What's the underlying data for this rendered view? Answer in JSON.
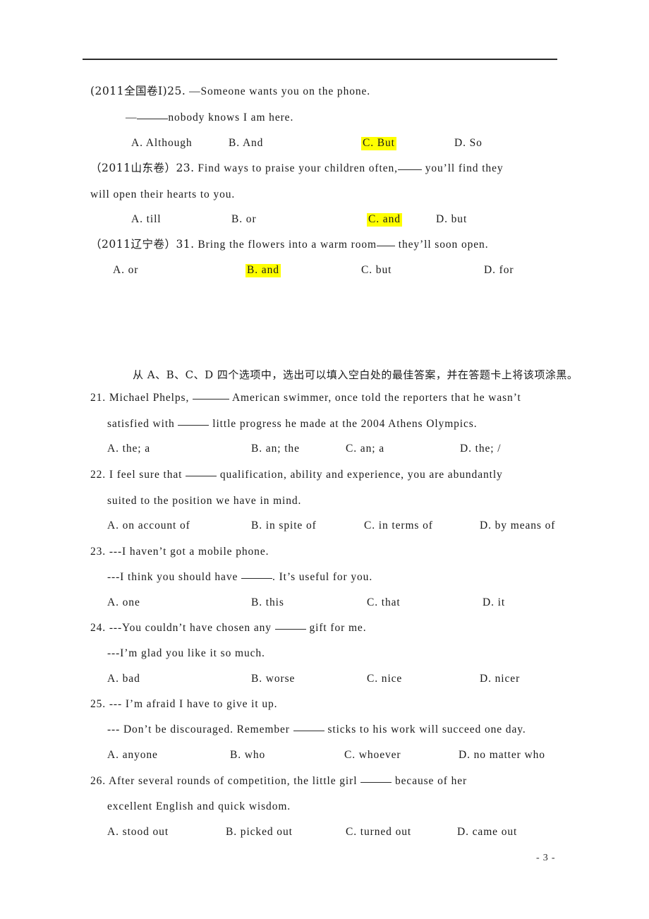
{
  "document": {
    "page_number_label": "- 3 -",
    "highlight_color": "#FFFF00",
    "rule_color": "#2b2b2b"
  },
  "section_one": {
    "items": [
      {
        "source": "(2011全国卷I)25.",
        "stem_line1": "—Someone wants you on the phone.",
        "stem_line2_pre": "—",
        "stem_line2_post": "nobody knows I am here.",
        "options": [
          {
            "key": "A.",
            "text": "Although",
            "highlighted": false
          },
          {
            "key": "B.",
            "text": "And",
            "highlighted": false
          },
          {
            "key": "C.",
            "text": "But",
            "highlighted": true
          },
          {
            "key": "D.",
            "text": "So",
            "highlighted": false
          }
        ]
      },
      {
        "source": "（2011山东卷）23.",
        "stem_line1_a": "Find ways to praise your children often,",
        "stem_line1_b": "you’ll find they",
        "stem_line2": "will open their hearts to you.",
        "options": [
          {
            "key": "A.",
            "text": "till",
            "highlighted": false
          },
          {
            "key": "B.",
            "text": "or",
            "highlighted": false
          },
          {
            "key": "C.",
            "text": "and",
            "highlighted": true
          },
          {
            "key": "D.",
            "text": "but",
            "highlighted": false
          }
        ]
      },
      {
        "source": "（2011辽宁卷）31.",
        "stem_line1_a": "Bring the flowers into a warm room",
        "stem_line1_b": "they’ll soon open.",
        "options": [
          {
            "key": "A.",
            "text": "or",
            "highlighted": false
          },
          {
            "key": "B.",
            "text": "and",
            "highlighted": true
          },
          {
            "key": "C.",
            "text": "but",
            "highlighted": false
          },
          {
            "key": "D.",
            "text": "for",
            "highlighted": false
          }
        ]
      }
    ]
  },
  "section_two": {
    "instruction": "从 A、B、C、D 四个选项中，选出可以填入空白处的最佳答案，并在答题卡上将该项涂黑。",
    "questions": [
      {
        "number": "21.",
        "line1_a": "Michael Phelps,",
        "line1_b": "American swimmer, once told the reporters that he wasn’t",
        "line2_a": "satisfied with",
        "line2_b": "little progress he made at the 2004 Athens Olympics.",
        "options": [
          {
            "key": "A.",
            "text": "the; a"
          },
          {
            "key": "B.",
            "text": "an; the"
          },
          {
            "key": "C.",
            "text": "an; a"
          },
          {
            "key": "D.",
            "text": "the; /"
          }
        ]
      },
      {
        "number": "22.",
        "line1_a": "I feel sure that",
        "line1_b": "qualification, ability and experience, you are abundantly",
        "line2_a": "suited to the position we have in mind.",
        "options": [
          {
            "key": "A.",
            "text": "on account of"
          },
          {
            "key": "B.",
            "text": "in spite of"
          },
          {
            "key": "C.",
            "text": "in terms of"
          },
          {
            "key": "D.",
            "text": "by means of"
          }
        ]
      },
      {
        "number": "23.",
        "line1_a": "---I haven’t got a mobile phone.",
        "line2_a": "---I think you should have",
        "line2_b": ". It’s useful for you.",
        "options": [
          {
            "key": "A.",
            "text": "one"
          },
          {
            "key": "B.",
            "text": "this"
          },
          {
            "key": "C.",
            "text": "that"
          },
          {
            "key": "D.",
            "text": "it"
          }
        ]
      },
      {
        "number": "24.",
        "line1_a": "---You couldn’t have chosen any",
        "line1_b": "gift for me.",
        "line2_a": "---I’m glad you like it so much.",
        "options": [
          {
            "key": "A.",
            "text": "bad"
          },
          {
            "key": "B.",
            "text": "worse"
          },
          {
            "key": "C.",
            "text": "nice"
          },
          {
            "key": "D.",
            "text": "nicer"
          }
        ]
      },
      {
        "number": "25.",
        "line1_a": "--- I’m afraid I have to give it up.",
        "line2_a": "--- Don’t be discouraged. Remember",
        "line2_b": "sticks to his work will succeed one day.",
        "options": [
          {
            "key": "A.",
            "text": "anyone"
          },
          {
            "key": "B.",
            "text": "who"
          },
          {
            "key": "C.",
            "text": "whoever"
          },
          {
            "key": "D.",
            "text": "no matter who"
          }
        ]
      },
      {
        "number": "26.",
        "line1_a": "After several rounds of competition, the little girl",
        "line1_b": "because of her",
        "line2_a": "excellent English and quick wisdom.",
        "options": [
          {
            "key": "A.",
            "text": "stood out"
          },
          {
            "key": "B.",
            "text": "picked out"
          },
          {
            "key": "C.",
            "text": "turned out"
          },
          {
            "key": "D.",
            "text": "came out"
          }
        ]
      }
    ]
  }
}
